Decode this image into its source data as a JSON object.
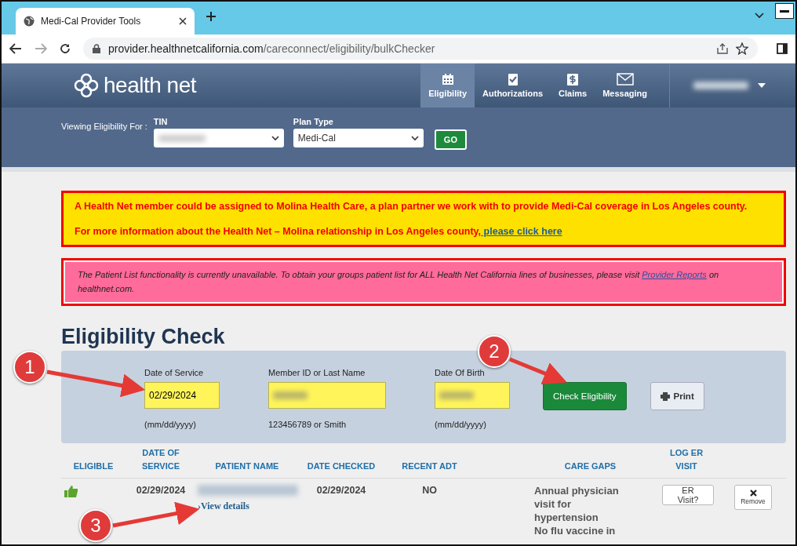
{
  "browser": {
    "tab_title": "Medi-Cal Provider Tools",
    "url_host": "provider.healthnetcalifornia.com",
    "url_path": "/careconnect/eligibility/bulkChecker"
  },
  "header": {
    "logo": "health net",
    "nav": [
      {
        "label": "Eligibility",
        "selected": true
      },
      {
        "label": "Authorizations",
        "selected": false
      },
      {
        "label": "Claims",
        "selected": false
      },
      {
        "label": "Messaging",
        "selected": false
      }
    ]
  },
  "filter": {
    "label": "Viewing Eligibility For :",
    "tin_label": "TIN",
    "plan_label": "Plan Type",
    "plan_value": "Medi-Cal",
    "go": "GO"
  },
  "notice": {
    "line1": "A Health Net member could be assigned to Molina Health Care, a plan partner we work with to provide Medi-Cal coverage in Los Angeles county.",
    "line2": "For more information about the Health Net – Molina relationship in Los Angeles county,",
    "link": " please click here"
  },
  "alert": {
    "text": "The Patient List functionality is currently unavailable. To obtain your groups patient list for ALL Health Net California lines of businesses, please visit",
    "link": "Provider Reports",
    "after": "on healthnet.com."
  },
  "heading": "Eligibility Check",
  "form": {
    "fields": [
      {
        "label": "Date of Service",
        "value": "02/29/2024",
        "hint": "(mm/dd/yyyy)"
      },
      {
        "label": "Member ID or Last Name",
        "hint": "123456789 or Smith"
      },
      {
        "label": "Date Of Birth",
        "hint": "(mm/dd/yyyy)"
      }
    ],
    "check_button": "Check Eligibility",
    "print_button": "Print"
  },
  "table": {
    "columns": [
      "ELIGIBLE",
      "DATE OF SERVICE",
      "PATIENT NAME",
      "DATE CHECKED",
      "RECENT ADT",
      "",
      "CARE GAPS",
      "LOG ER VISIT",
      ""
    ],
    "rows": [
      {
        "eligible": true,
        "date_of_service": "02/29/2024",
        "details_link": "›View details",
        "date_checked": "02/29/2024",
        "recent_adt": "NO",
        "care_gaps": [
          "Annual physician visit for hypertension",
          "No flu vaccine in"
        ],
        "er_button": "ER Visit?",
        "remove_button": "Remove"
      }
    ]
  },
  "annotations": [
    {
      "number": "1"
    },
    {
      "number": "2"
    },
    {
      "number": "3"
    }
  ]
}
